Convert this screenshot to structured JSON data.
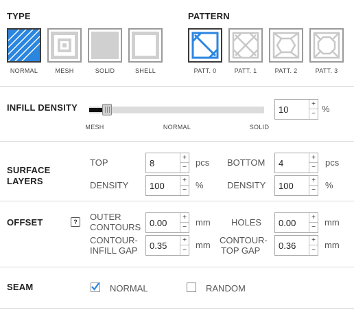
{
  "type": {
    "heading": "TYPE",
    "options": [
      {
        "label": "NORMAL",
        "icon": "normal-infill-icon",
        "selected": true
      },
      {
        "label": "MESH",
        "icon": "mesh-infill-icon",
        "selected": false
      },
      {
        "label": "SOLID",
        "icon": "solid-infill-icon",
        "selected": false
      },
      {
        "label": "SHELL",
        "icon": "shell-infill-icon",
        "selected": false
      }
    ]
  },
  "pattern": {
    "heading": "PATTERN",
    "options": [
      {
        "label": "PATT. 0",
        "icon": "pattern-0-icon",
        "selected": true
      },
      {
        "label": "PATT. 1",
        "icon": "pattern-1-icon",
        "selected": false
      },
      {
        "label": "PATT. 2",
        "icon": "pattern-2-icon",
        "selected": false
      },
      {
        "label": "PATT. 3",
        "icon": "pattern-3-icon",
        "selected": false
      }
    ]
  },
  "infill": {
    "heading": "INFILL DENSITY",
    "value": "10",
    "unit": "%",
    "slider_level_percent": 10,
    "marks": [
      "MESH",
      "NORMAL",
      "SOLID"
    ]
  },
  "surface": {
    "heading_line1": "SURFACE",
    "heading_line2": "LAYERS",
    "top_label": "TOP",
    "top_value": "8",
    "top_unit": "pcs",
    "bottom_label": "BOTTOM",
    "bottom_value": "4",
    "bottom_unit": "pcs",
    "density_label": "DENSITY",
    "top_density_value": "100",
    "bottom_density_value": "100",
    "density_unit": "%"
  },
  "offset": {
    "heading": "OFFSET",
    "help_glyph": "?",
    "outer_contours_line1": "OUTER",
    "outer_contours_line2": "CONTOURS",
    "outer_contours_value": "0.00",
    "holes_label": "HOLES",
    "holes_value": "0.00",
    "contour_infill_line1": "CONTOUR-",
    "contour_infill_line2": "INFILL GAP",
    "contour_infill_value": "0.35",
    "contour_top_line1": "CONTOUR-",
    "contour_top_line2": "TOP GAP",
    "contour_top_value": "0.36",
    "unit": "mm"
  },
  "seam": {
    "heading": "SEAM",
    "normal_label": "NORMAL",
    "normal_checked": true,
    "random_label": "RANDOM",
    "random_checked": false
  },
  "colors": {
    "accent": "#2b86e0",
    "divider": "#d8d8d8",
    "tile_border": "#9a9a9a",
    "tile_gray": "#d0d0d0"
  }
}
